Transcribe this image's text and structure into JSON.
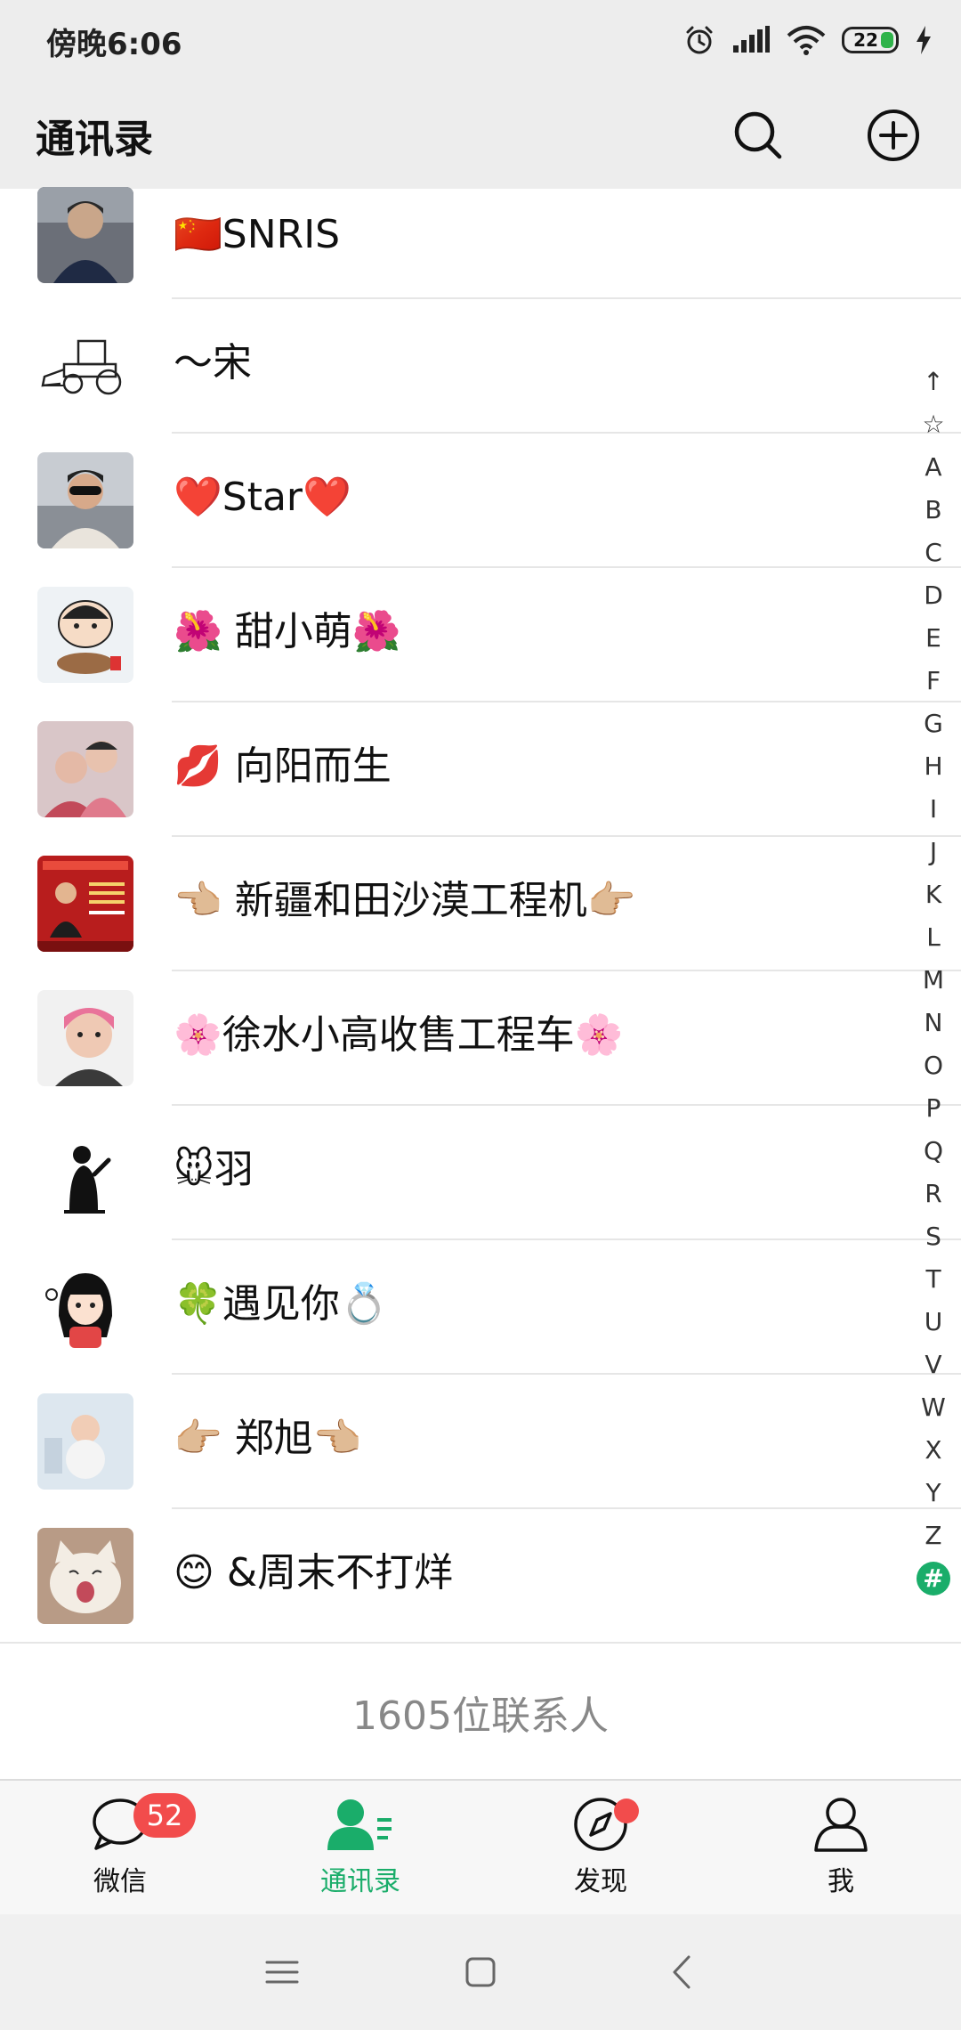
{
  "status_bar": {
    "time": "傍晚6:06",
    "battery": "22",
    "icons": [
      "alarm-icon",
      "signal-icon",
      "wifi-icon",
      "battery-icon",
      "charging-icon"
    ]
  },
  "header": {
    "title": "通讯录",
    "icons": [
      "search-icon",
      "add-icon"
    ]
  },
  "contacts": [
    {
      "name": "🇨🇳SNRIS",
      "avatar": "photo-avatar"
    },
    {
      "name": "～宋",
      "avatar": "loader-sketch-avatar"
    },
    {
      "name": "❤️Star❤️",
      "avatar": "photo-avatar"
    },
    {
      "name": "🌺 甜小萌🌺",
      "avatar": "cartoon-avatar"
    },
    {
      "name": "💋 向阳而生",
      "avatar": "photo-avatar"
    },
    {
      "name": "👈🏼 新疆和田沙漠工程机👉🏼",
      "avatar": "ad-avatar"
    },
    {
      "name": "🌸徐水小高收售工程车🌸",
      "avatar": "photo-avatar"
    },
    {
      "name": "🐭羽",
      "avatar": "silhouette-avatar"
    },
    {
      "name": "🍀遇见你💍",
      "avatar": "cartoon-girl-avatar"
    },
    {
      "name": "👉🏼 郑旭👈🏼",
      "avatar": "baby-photo-avatar"
    },
    {
      "name": "😊 &周末不打烊",
      "avatar": "cat-photo-avatar"
    }
  ],
  "contact_count": "1605位联系人",
  "alphabet_index": [
    "↑",
    "☆",
    "A",
    "B",
    "C",
    "D",
    "E",
    "F",
    "G",
    "H",
    "I",
    "J",
    "K",
    "L",
    "M",
    "N",
    "O",
    "P",
    "Q",
    "R",
    "S",
    "T",
    "U",
    "V",
    "W",
    "X",
    "Y",
    "Z",
    "#"
  ],
  "alphabet_active": "#",
  "tabs": [
    {
      "label": "微信",
      "icon": "chat-icon",
      "badge": "52"
    },
    {
      "label": "通讯录",
      "icon": "contacts-icon",
      "active": true
    },
    {
      "label": "发现",
      "icon": "compass-icon",
      "dot": true
    },
    {
      "label": "我",
      "icon": "person-icon"
    }
  ],
  "system_nav": [
    "menu-icon",
    "home-icon",
    "back-icon"
  ],
  "colors": {
    "accent": "#1aad6a",
    "badge": "#f24c4c",
    "header_bg": "#ededed"
  }
}
